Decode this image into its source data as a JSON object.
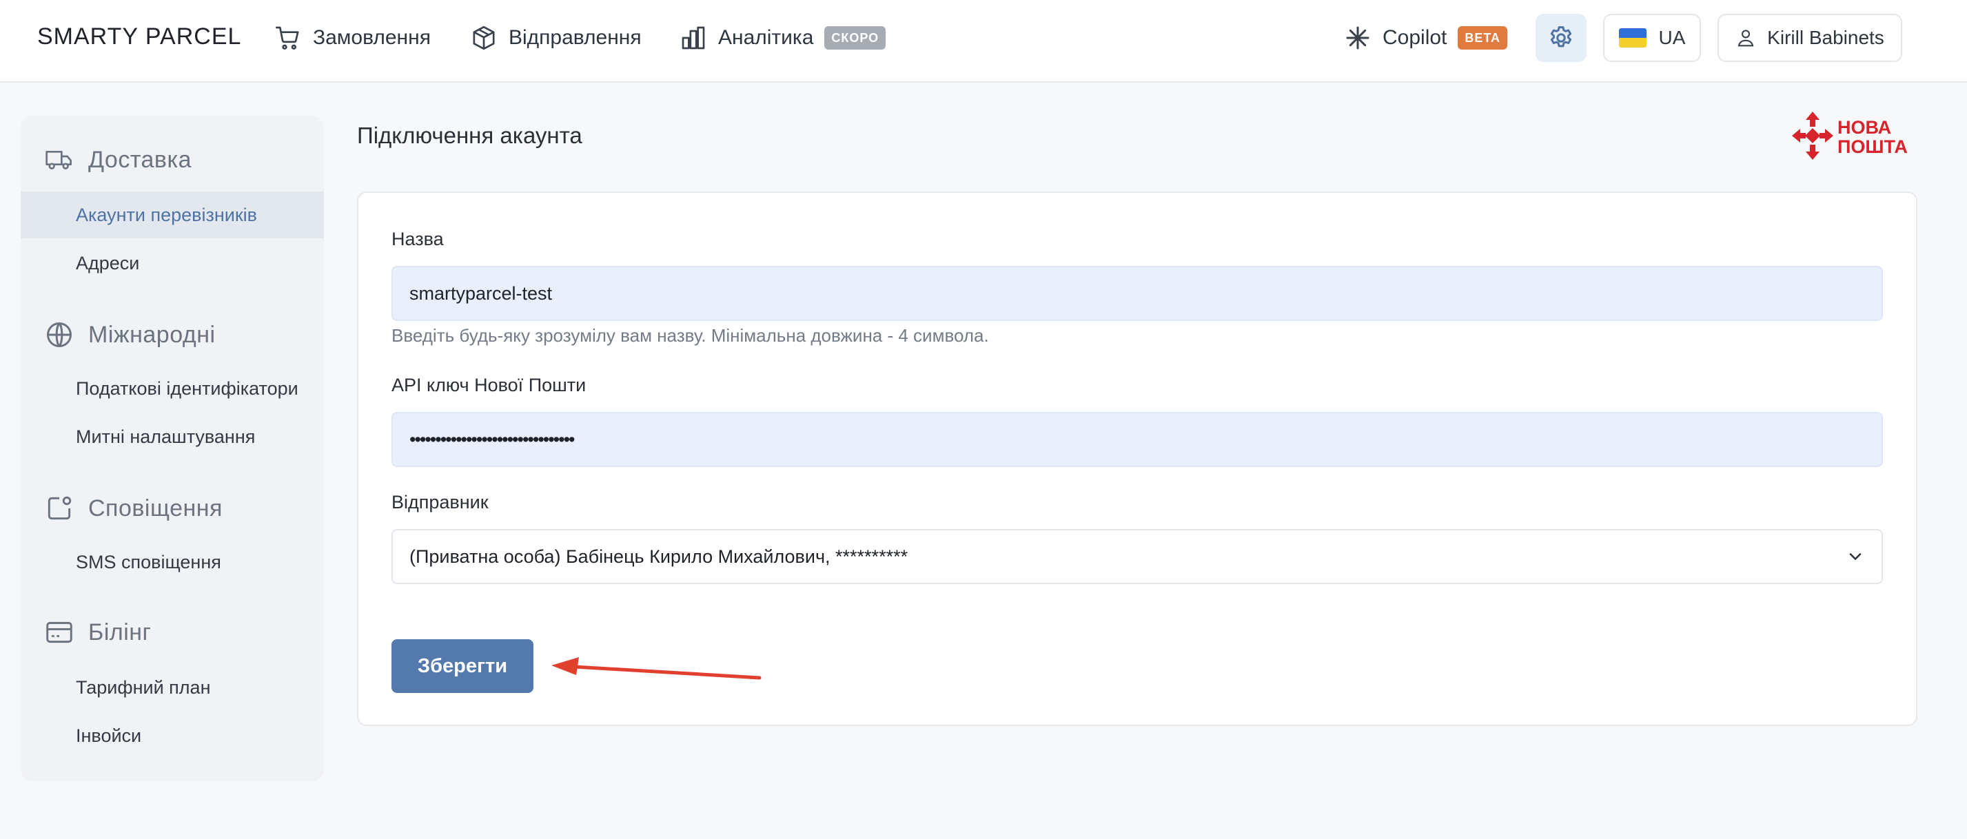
{
  "brand": "SMARTY PARCEL",
  "nav": {
    "orders": "Замовлення",
    "shipments": "Відправлення",
    "analytics": "Аналітика",
    "analytics_badge": "СКОРО",
    "copilot": "Copilot",
    "copilot_badge": "BETA",
    "language": "UA",
    "user": "Kirill Babinets"
  },
  "sidebar": {
    "sections": [
      {
        "title": "Доставка",
        "icon": "truck-icon",
        "items": [
          "Акаунти перевізників",
          "Адреси"
        ]
      },
      {
        "title": "Міжнародні",
        "icon": "globe-icon",
        "items": [
          "Податкові ідентифікатори",
          "Митні налаштування"
        ]
      },
      {
        "title": "Сповіщення",
        "icon": "notification-icon",
        "items": [
          "SMS сповіщення"
        ]
      },
      {
        "title": "Білінг",
        "icon": "credit-card-icon",
        "items": [
          "Тарифний план",
          "Інвойси"
        ]
      }
    ],
    "active_item": "Акаунти перевізників"
  },
  "page": {
    "title": "Підключення акаунта",
    "logo_text_line1": "НОВА",
    "logo_text_line2": "ПОШТА"
  },
  "form": {
    "name_label": "Назва",
    "name_value": "smartyparcel-test",
    "name_hint": "Введіть будь-яку зрозумілу вам назву. Мінімальна довжина - 4 символа.",
    "api_key_label": "API ключ Нової Пошти",
    "api_key_value": "••••••••••••••••••••••••••••••••",
    "sender_label": "Відправник",
    "sender_value": "(Приватна особа) Бабінець Кирило Михайлович, **********",
    "save_label": "Зберегти"
  },
  "colors": {
    "accent": "#5479ad",
    "active_bg": "#e3e8ef",
    "input_bg": "#e9effd",
    "badge_beta": "#e07a3e",
    "arrow": "#e2402e",
    "np_red": "#d7242c"
  }
}
